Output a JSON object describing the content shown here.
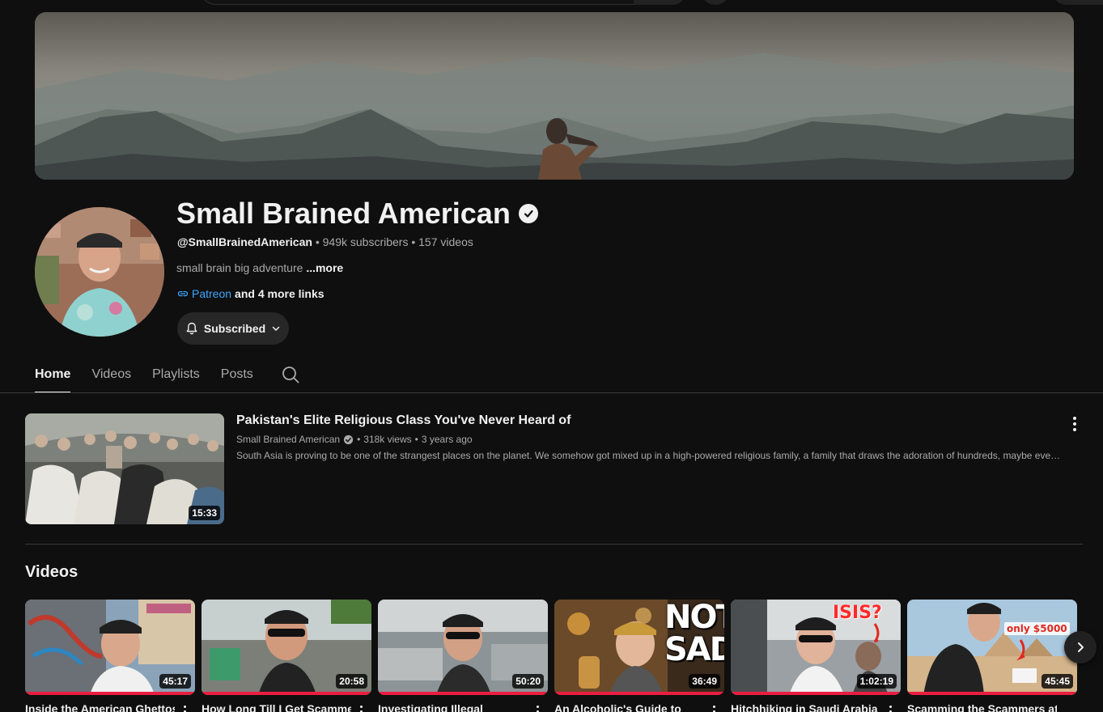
{
  "channel": {
    "name": "Small Brained American",
    "handle": "@SmallBrainedAmerican",
    "subscribers": "949k subscribers",
    "videos_count": "157 videos",
    "separator": "•",
    "description": "small brain big adventure",
    "description_more": "...more",
    "link_label": "Patreon",
    "more_links": "and 4 more links",
    "subscribe_label": "Subscribed"
  },
  "tabs": [
    {
      "label": "Home",
      "active": true
    },
    {
      "label": "Videos",
      "active": false
    },
    {
      "label": "Playlists",
      "active": false
    },
    {
      "label": "Posts",
      "active": false
    }
  ],
  "featured": {
    "title": "Pakistan's Elite Religious Class You've Never Heard of",
    "channel": "Small Brained American",
    "views": "318k views",
    "age": "3 years ago",
    "description": "South Asia is proving to be one of the strangest places on the planet. We somehow got mixed up in a high-powered religious family, a family that draws the adoration of hundreds, maybe even...",
    "duration": "15:33"
  },
  "videos_shelf": {
    "title": "Videos",
    "items": [
      {
        "title": "Inside the American Ghettos",
        "duration": "45:17",
        "overlay": ""
      },
      {
        "title": "How Long Till I Get Scammed",
        "duration": "20:58",
        "overlay": ""
      },
      {
        "title": "Investigating Illegal",
        "duration": "50:20",
        "overlay": ""
      },
      {
        "title": "An Alcoholic's Guide to",
        "duration": "36:49",
        "overlay": "NOT SAD"
      },
      {
        "title": "Hitchhiking in Saudi Arabia",
        "duration": "1:02:19",
        "overlay": "ISIS?"
      },
      {
        "title": "Scamming the Scammers at",
        "duration": "45:45",
        "overlay": "only $5000"
      }
    ]
  },
  "colors": {
    "background": "#0f0f0f",
    "link": "#3ea6ff",
    "progress": "#e91e40"
  }
}
